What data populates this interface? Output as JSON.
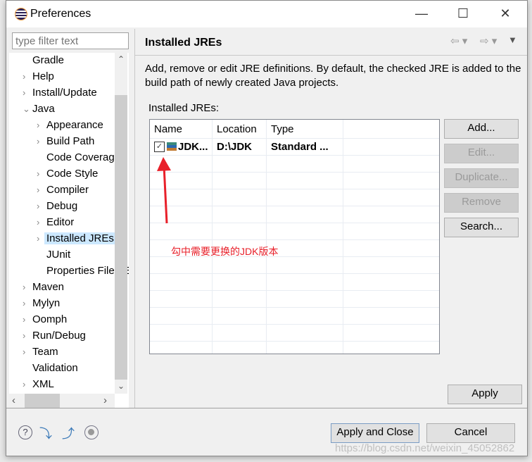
{
  "window": {
    "title": "Preferences",
    "minimize": "—",
    "maximize": "☐",
    "close": "✕"
  },
  "filter": {
    "placeholder": "type filter text"
  },
  "tree": [
    {
      "label": "Gradle",
      "level": 0,
      "arrow": ""
    },
    {
      "label": "Help",
      "level": 0,
      "arrow": "›"
    },
    {
      "label": "Install/Update",
      "level": 0,
      "arrow": "›"
    },
    {
      "label": "Java",
      "level": 0,
      "arrow": "⌄"
    },
    {
      "label": "Appearance",
      "level": 1,
      "arrow": "›"
    },
    {
      "label": "Build Path",
      "level": 1,
      "arrow": "›"
    },
    {
      "label": "Code Coverage",
      "level": 1,
      "arrow": ""
    },
    {
      "label": "Code Style",
      "level": 1,
      "arrow": "›"
    },
    {
      "label": "Compiler",
      "level": 1,
      "arrow": "›"
    },
    {
      "label": "Debug",
      "level": 1,
      "arrow": "›"
    },
    {
      "label": "Editor",
      "level": 1,
      "arrow": "›"
    },
    {
      "label": "Installed JREs",
      "level": 1,
      "arrow": "›",
      "selected": true
    },
    {
      "label": "JUnit",
      "level": 1,
      "arrow": ""
    },
    {
      "label": "Properties Files Editor",
      "level": 1,
      "arrow": ""
    },
    {
      "label": "Maven",
      "level": 0,
      "arrow": "›"
    },
    {
      "label": "Mylyn",
      "level": 0,
      "arrow": "›"
    },
    {
      "label": "Oomph",
      "level": 0,
      "arrow": "›"
    },
    {
      "label": "Run/Debug",
      "level": 0,
      "arrow": "›"
    },
    {
      "label": "Team",
      "level": 0,
      "arrow": "›"
    },
    {
      "label": "Validation",
      "level": 0,
      "arrow": ""
    },
    {
      "label": "XML",
      "level": 0,
      "arrow": "›"
    }
  ],
  "page": {
    "title": "Installed JREs",
    "description": "Add, remove or edit JRE definitions. By default, the checked JRE is added to the build path of newly created Java projects.",
    "list_label": "Installed JREs:"
  },
  "table": {
    "columns": [
      "Name",
      "Location",
      "Type"
    ],
    "rows": [
      {
        "name": "JDK...",
        "location": "D:\\JDK",
        "type": "Standard ...",
        "checked": true
      }
    ]
  },
  "buttons": {
    "add": "Add...",
    "edit": "Edit...",
    "duplicate": "Duplicate...",
    "remove": "Remove",
    "search": "Search...",
    "apply": "Apply",
    "apply_close": "Apply and Close",
    "cancel": "Cancel"
  },
  "annotation": {
    "text": "勾中需要更换的JDK版本",
    "color": "#e8202a"
  },
  "watermark": "https://blog.csdn.net/weixin_45052862"
}
